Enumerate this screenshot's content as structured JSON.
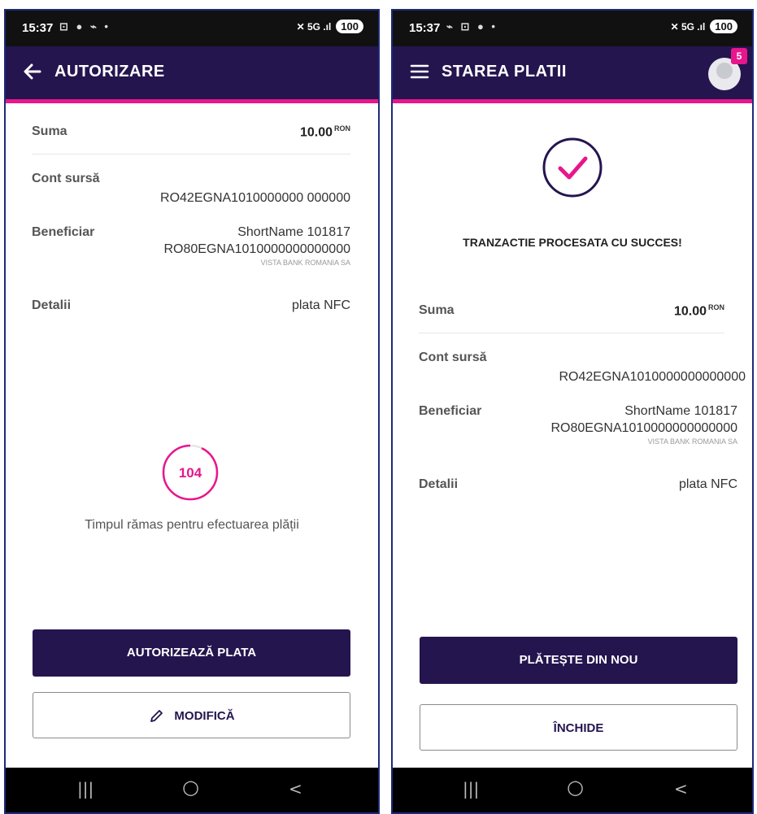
{
  "left": {
    "status": {
      "time": "15:37",
      "left_icons": "⊡ ● ⌁ •",
      "right_icons": "✕ 5G .ıl",
      "battery": "100"
    },
    "title": "AUTORIZARE",
    "rows": {
      "suma_label": "Suma",
      "suma_value": "10.00",
      "currency": "RON",
      "cont_label": "Cont sursă",
      "cont_value": "RO42EGNA1010000000 000000",
      "benef_label": "Beneficiar",
      "benef_name": "ShortName 101817",
      "benef_iban": "RO80EGNA1010000000000000",
      "benef_bank": "VISTA BANK ROMANIA SA",
      "detalii_label": "Detalii",
      "detalii_value": "plata NFC"
    },
    "timer": {
      "value": "104",
      "progress": 0.93,
      "caption": "Timpul rămas pentru efectuarea plății"
    },
    "buttons": {
      "authorize": "AUTORIZEAZĂ PLATA",
      "modify": "MODIFICĂ"
    },
    "navbar": {
      "recents": "|||",
      "home": "○",
      "back": "<"
    }
  },
  "right": {
    "status": {
      "time": "15:37",
      "left_icons": "⌁ ⊡ ● •",
      "right_icons": "✕ 5G .ıl",
      "battery": "100"
    },
    "title": "STAREA PLATII",
    "badge": "5",
    "success": "TRANZACTIE PROCESATA CU SUCCES!",
    "rows": {
      "suma_label": "Suma",
      "suma_value": "10.00",
      "currency": "RON",
      "cont_label": "Cont sursă",
      "cont_value": "RO42EGNA1010000000000000",
      "benef_label": "Beneficiar",
      "benef_name": "ShortName 101817",
      "benef_iban": "RO80EGNA1010000000000000",
      "benef_bank": "VISTA BANK ROMANIA SA",
      "detalii_label": "Detalii",
      "detalii_value": "plata NFC"
    },
    "buttons": {
      "pay_again": "PLĂTEȘTE DIN NOU",
      "close": "ÎNCHIDE"
    },
    "navbar": {
      "recents": "|||",
      "home": "○",
      "back": "<"
    }
  },
  "colors": {
    "navy": "#24154f",
    "accent": "#e8168c",
    "frame": "#1e2a78"
  }
}
